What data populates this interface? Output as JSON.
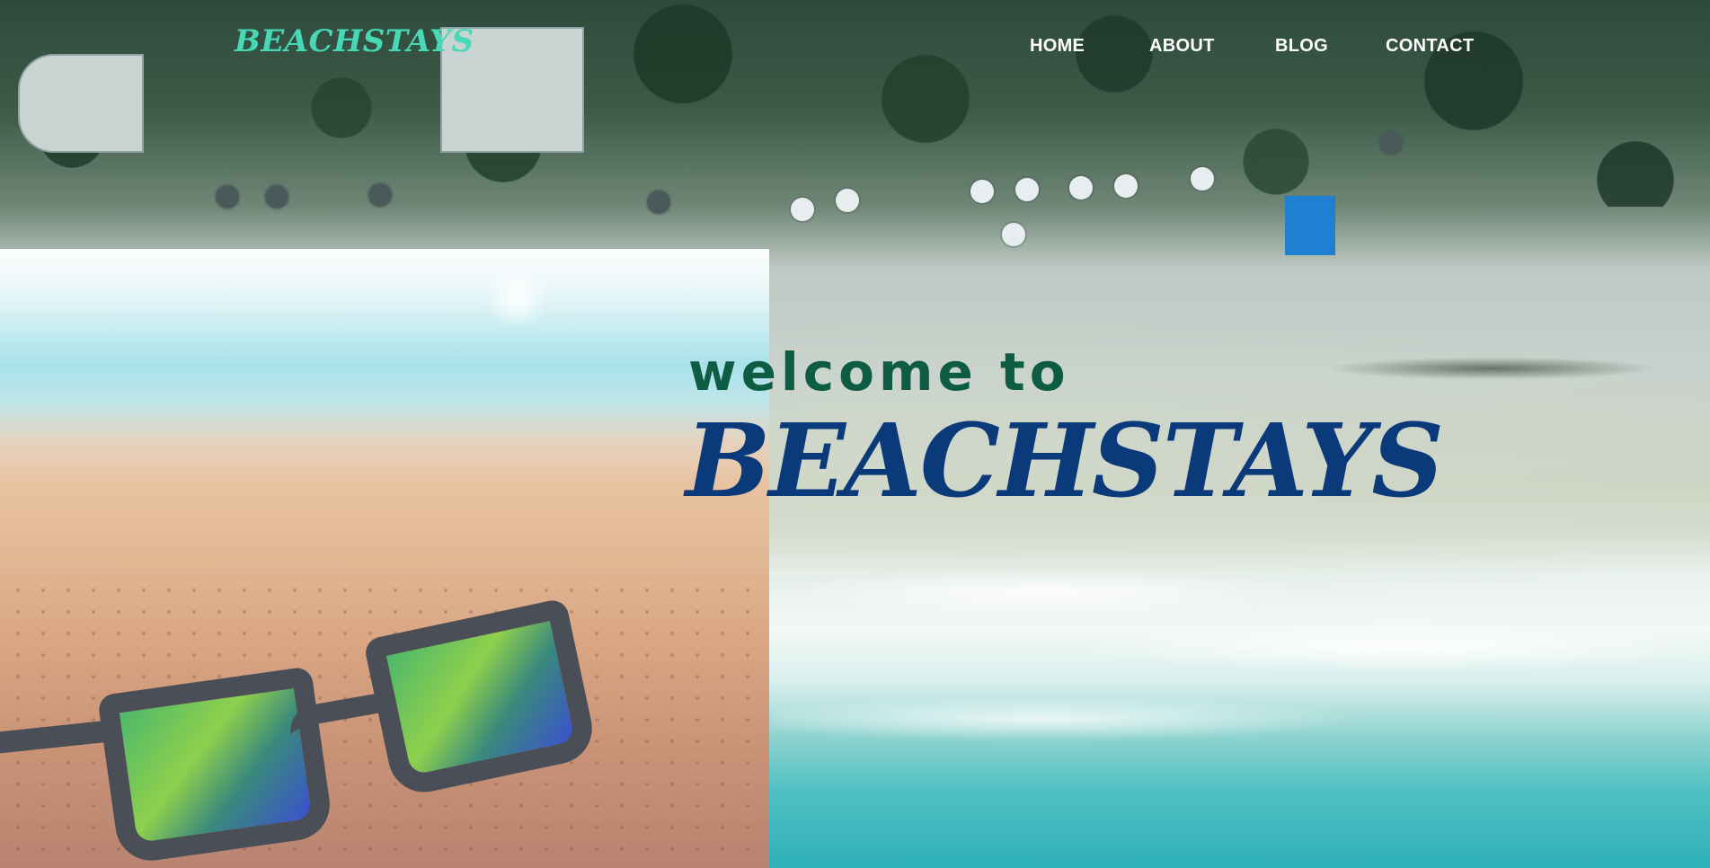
{
  "nav": {
    "logo": "BEACHSTAYS",
    "items": [
      {
        "label": "HOME"
      },
      {
        "label": "ABOUT"
      },
      {
        "label": "BLOG"
      },
      {
        "label": "CONTACT"
      }
    ]
  },
  "hero": {
    "welcome": "welcome to",
    "brand": "BEACHSTAYS"
  },
  "colors": {
    "logo": "#48d8b6",
    "welcome": "#0f5c45",
    "brand": "#0b3a7a",
    "nav_text": "#ffffff"
  },
  "images": {
    "background": "aerial-beach-image",
    "panel": "sunglasses-on-sand-image"
  }
}
